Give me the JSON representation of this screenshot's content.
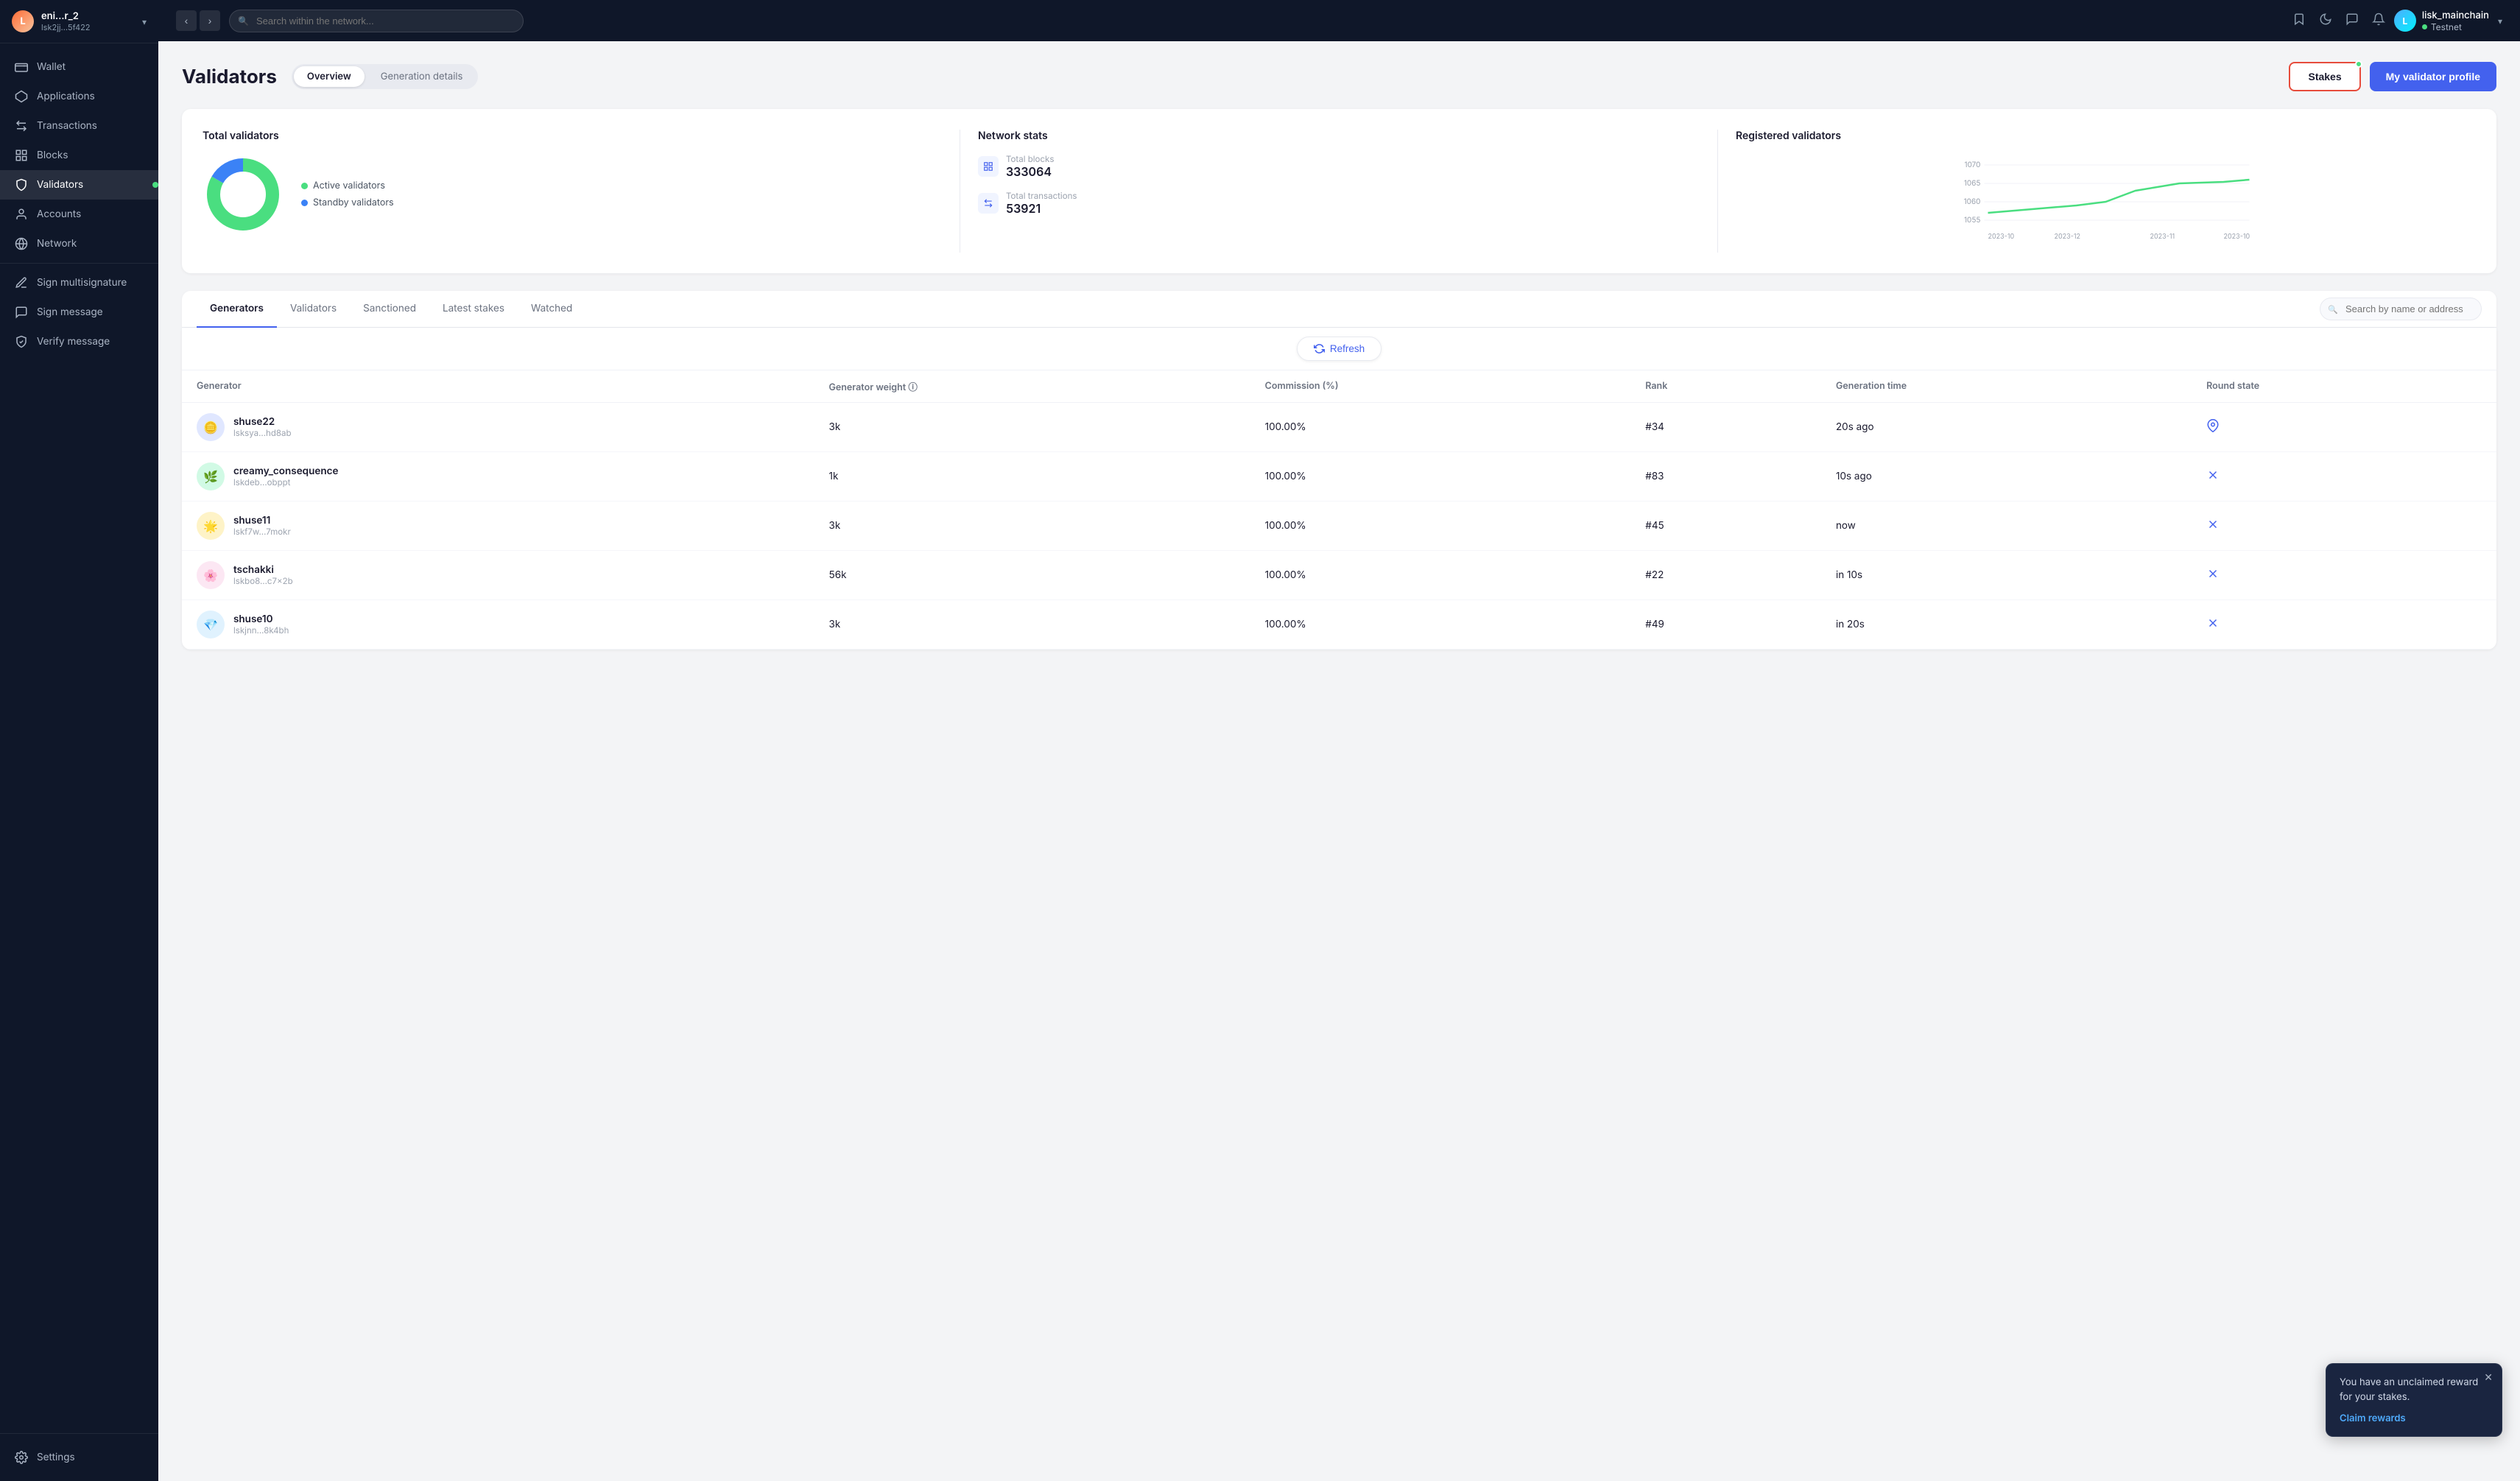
{
  "app": {
    "logo_initials": "L",
    "account_name": "eni...r_2",
    "account_address": "lsk2jj...5f422"
  },
  "sidebar": {
    "items": [
      {
        "id": "wallet",
        "label": "Wallet",
        "icon": "💳"
      },
      {
        "id": "applications",
        "label": "Applications",
        "icon": "⬡"
      },
      {
        "id": "transactions",
        "label": "Transactions",
        "icon": "↔"
      },
      {
        "id": "blocks",
        "label": "Blocks",
        "icon": "⬛"
      },
      {
        "id": "validators",
        "label": "Validators",
        "icon": "✓",
        "active": true
      },
      {
        "id": "accounts",
        "label": "Accounts",
        "icon": "👤"
      },
      {
        "id": "network",
        "label": "Network",
        "icon": "⊙"
      }
    ],
    "bottom_items": [
      {
        "id": "sign-multisig",
        "label": "Sign multisignature",
        "icon": "✍"
      },
      {
        "id": "sign-message",
        "label": "Sign message",
        "icon": "📝"
      },
      {
        "id": "verify-message",
        "label": "Verify message",
        "icon": "🛡"
      }
    ],
    "settings_label": "Settings"
  },
  "topbar": {
    "search_placeholder": "Search within the network...",
    "profile_name": "lisk_mainchain",
    "network_label": "Testnet",
    "back_label": "←",
    "forward_label": "→"
  },
  "page": {
    "title": "Validators",
    "tabs": [
      {
        "id": "overview",
        "label": "Overview",
        "active": true
      },
      {
        "id": "generation-details",
        "label": "Generation details"
      }
    ],
    "stakes_button": "Stakes",
    "validator_profile_button": "My validator profile"
  },
  "total_validators": {
    "title": "Total validators",
    "legend": [
      {
        "label": "Active validators",
        "color": "#4ade80"
      },
      {
        "label": "Standby validators",
        "color": "#3b82f6"
      }
    ],
    "donut": {
      "active_pct": 83,
      "standby_pct": 17
    }
  },
  "network_stats": {
    "title": "Network stats",
    "total_blocks_label": "Total blocks",
    "total_blocks_value": "333064",
    "total_transactions_label": "Total transactions",
    "total_transactions_value": "53921"
  },
  "registered_validators": {
    "title": "Registered validators",
    "chart_y_labels": [
      "1070",
      "1065",
      "1060",
      "1055"
    ],
    "chart_x_labels": [
      "2023-10",
      "2023-12",
      "2023-11",
      "2023-10"
    ]
  },
  "generator_tabs": [
    {
      "id": "generators",
      "label": "Generators",
      "active": true
    },
    {
      "id": "validators",
      "label": "Validators"
    },
    {
      "id": "sanctioned",
      "label": "Sanctioned"
    },
    {
      "id": "latest-stakes",
      "label": "Latest stakes"
    },
    {
      "id": "watched",
      "label": "Watched"
    }
  ],
  "search": {
    "placeholder": "Search by name or address"
  },
  "refresh_label": "Refresh",
  "table": {
    "columns": [
      {
        "id": "generator",
        "label": "Generator"
      },
      {
        "id": "weight",
        "label": "Generator weight ⓘ"
      },
      {
        "id": "commission",
        "label": "Commission (%)"
      },
      {
        "id": "rank",
        "label": "Rank"
      },
      {
        "id": "generation_time",
        "label": "Generation time"
      },
      {
        "id": "round_state",
        "label": "Round state"
      }
    ],
    "rows": [
      {
        "id": "shuse22",
        "name": "shuse22",
        "address": "lsksya...hd8ab",
        "weight": "3k",
        "commission": "100.00%",
        "rank": "#34",
        "generation_time": "20s ago",
        "round_state_icon": "📌",
        "avatar_bg": "#e0e7ff",
        "avatar_text": "🪙"
      },
      {
        "id": "creamy_consequence",
        "name": "creamy_consequence",
        "address": "lskdeb...obppt",
        "weight": "1k",
        "commission": "100.00%",
        "rank": "#83",
        "generation_time": "10s ago",
        "round_state_icon": "✕",
        "avatar_bg": "#d1fae5",
        "avatar_text": "🌿"
      },
      {
        "id": "shuse11",
        "name": "shuse11",
        "address": "lskf7w...7mokr",
        "weight": "3k",
        "commission": "100.00%",
        "rank": "#45",
        "generation_time": "now",
        "round_state_icon": "✕",
        "avatar_bg": "#fef3c7",
        "avatar_text": "🌟"
      },
      {
        "id": "tschakki",
        "name": "tschakki",
        "address": "lskbo8...c7x2b",
        "weight": "56k",
        "commission": "100.00%",
        "rank": "#22",
        "generation_time": "in 10s",
        "round_state_icon": "",
        "avatar_bg": "#fce7f3",
        "avatar_text": "🌸"
      },
      {
        "id": "shuse10",
        "name": "shuse10",
        "address": "lskjnn...8k4bh",
        "weight": "3k",
        "commission": "100.00%",
        "rank": "#49",
        "generation_time": "in 20s",
        "round_state_icon": "",
        "avatar_bg": "#e0f2fe",
        "avatar_text": "💎"
      }
    ]
  },
  "toast": {
    "text": "You have an unclaimed reward for your stakes.",
    "link_label": "Claim rewards"
  }
}
